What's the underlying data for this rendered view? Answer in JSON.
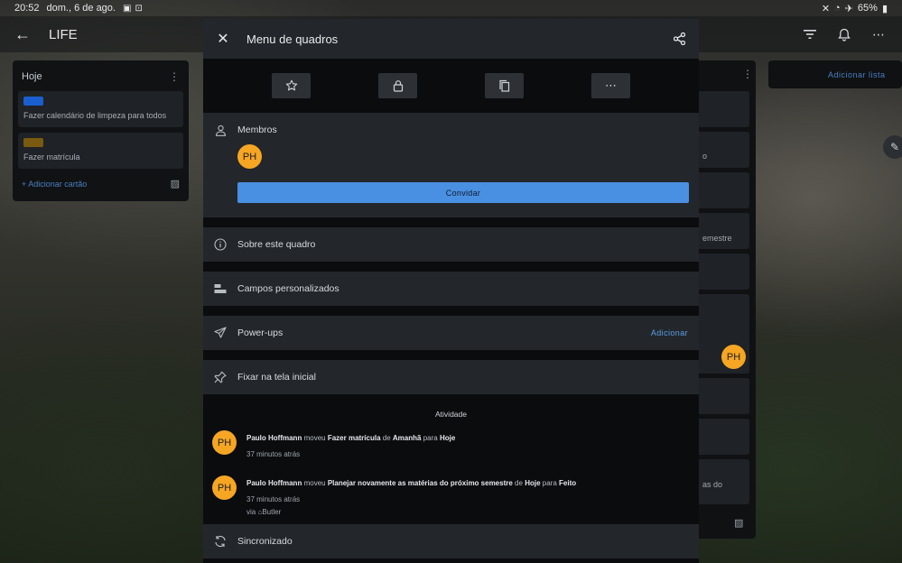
{
  "status_bar": {
    "time": "20:52",
    "date": "dom., 6 de ago.",
    "battery": "65%"
  },
  "app_bar": {
    "title": "LIFE"
  },
  "list_hoje": {
    "title": "Hoje",
    "cards": [
      {
        "label_color": "#1a5fcf",
        "text": "Fazer calendário de limpeza para todos"
      },
      {
        "label_color": "#7a5a10",
        "text": "Fazer matrícula"
      }
    ],
    "add_card": "+ Adicionar cartão"
  },
  "list_right": {
    "partial_texts": [
      "o",
      "emestre",
      "as do"
    ],
    "member_initials": "PH"
  },
  "add_list": "Adicionar lista",
  "panel": {
    "title": "Menu de quadros",
    "members": {
      "label": "Membros",
      "avatar_initials": "PH",
      "invite_label": "Convidar"
    },
    "rows": {
      "about": "Sobre este quadro",
      "custom_fields": "Campos personalizados",
      "powerups": "Power-ups",
      "powerups_action": "Adicionar",
      "pin": "Fixar na tela inicial"
    },
    "activity": {
      "title": "Atividade",
      "items": [
        {
          "initials": "PH",
          "user": "Paulo Hoffmann",
          "verb": "moveu",
          "card": "Fazer matrícula",
          "from_word": "de",
          "from": "Amanhã",
          "to_word": "para",
          "to": "Hoje",
          "ago": "37 minutos atrás"
        },
        {
          "initials": "PH",
          "user": "Paulo Hoffmann",
          "verb": "moveu",
          "card": "Planejar novamente as matérias do próximo semestre",
          "from_word": "de",
          "from": "Hoje",
          "to_word": "para",
          "to": "Feito",
          "ago": "37 minutos atrás",
          "via": "via",
          "via_name": "Butler"
        }
      ]
    },
    "sync": "Sincronizado"
  }
}
